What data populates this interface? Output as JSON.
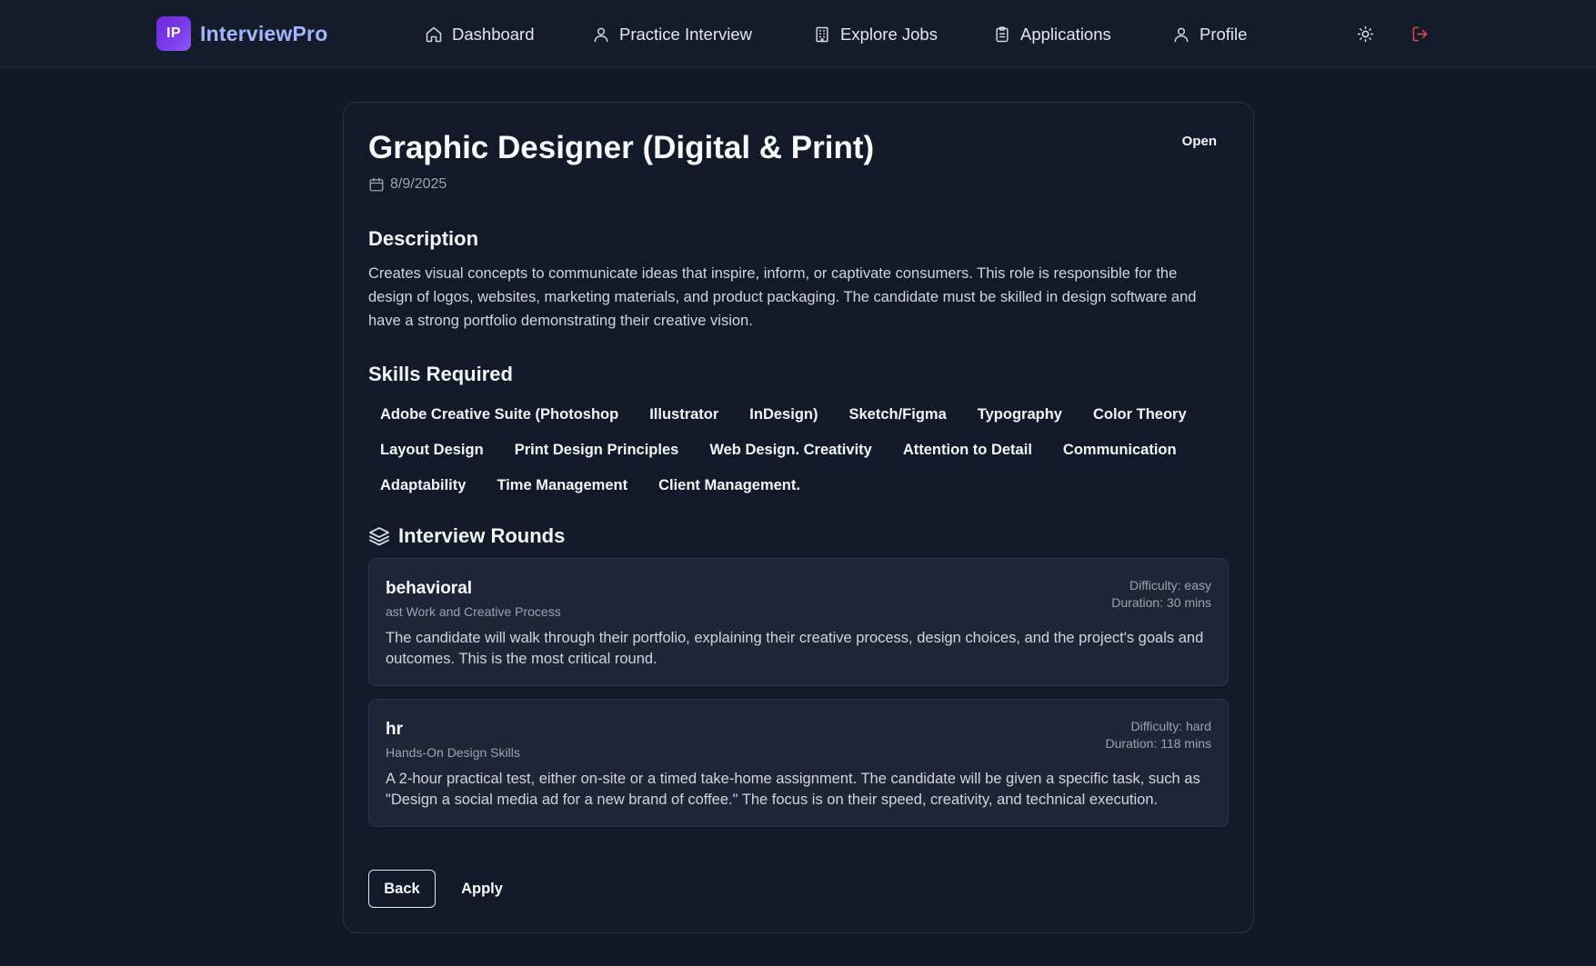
{
  "brand": {
    "logo_text": "IP",
    "name": "InterviewPro"
  },
  "nav": {
    "items": [
      {
        "label": "Dashboard",
        "icon": "home-icon"
      },
      {
        "label": "Practice Interview",
        "icon": "user-icon"
      },
      {
        "label": "Explore Jobs",
        "icon": "building-icon"
      },
      {
        "label": "Applications",
        "icon": "clipboard-icon"
      },
      {
        "label": "Profile",
        "icon": "user-icon"
      }
    ],
    "theme_toggle_icon": "sun-icon",
    "logout_icon": "logout-icon",
    "logout_color": "#ef4444"
  },
  "job": {
    "title": "Graphic Designer (Digital & Print)",
    "status": "Open",
    "date": "8/9/2025",
    "description_heading": "Description",
    "description": "Creates visual concepts to communicate ideas that inspire, inform, or captivate consumers. This role is responsible for the design of logos, websites, marketing materials, and product packaging. The candidate must be skilled in design software and have a strong portfolio demonstrating their creative vision.",
    "skills_heading": "Skills Required",
    "skills": [
      "Adobe Creative Suite (Photoshop",
      "Illustrator",
      "InDesign)",
      "Sketch/Figma",
      "Typography",
      "Color Theory",
      "Layout Design",
      "Print Design Principles",
      "Web Design. Creativity",
      "Attention to Detail",
      "Communication",
      "Adaptability",
      "Time Management",
      "Client Management."
    ],
    "rounds_heading": "Interview Rounds",
    "rounds": [
      {
        "type": "behavioral",
        "subtitle": "ast Work and Creative Process",
        "difficulty": "Difficulty: easy",
        "duration": "Duration: 30 mins",
        "description": "The candidate will walk through their portfolio, explaining their creative process, design choices, and the project's goals and outcomes. This is the most critical round."
      },
      {
        "type": "hr",
        "subtitle": "Hands-On Design Skills",
        "difficulty": "Difficulty: hard",
        "duration": "Duration: 118 mins",
        "description": "A 2-hour practical test, either on-site or a timed take-home assignment. The candidate will be given a specific task, such as \"Design a social media ad for a new brand of coffee.\" The focus is on their speed, creativity, and technical execution."
      }
    ]
  },
  "actions": {
    "back_label": "Back",
    "apply_label": "Apply"
  },
  "colors": {
    "background": "#111828",
    "card": "#121a2a",
    "round_card": "#1e2536",
    "brand_accent": "#7c3aed",
    "brand_text": "#a5b4fc"
  }
}
